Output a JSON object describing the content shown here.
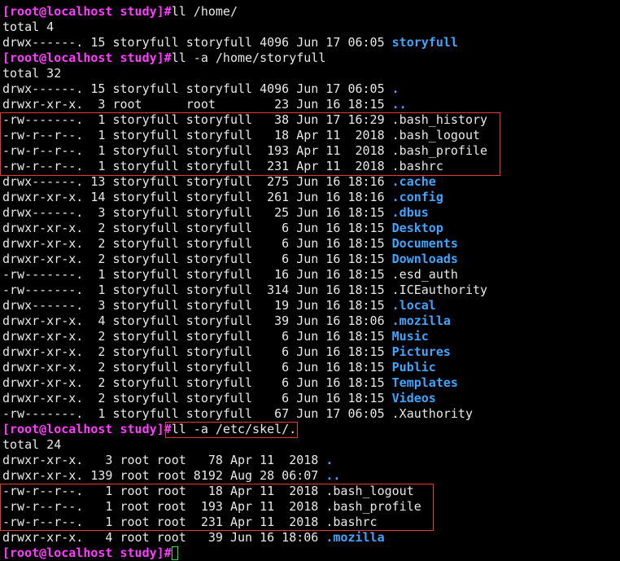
{
  "terminal": {
    "colors": {
      "prompt": "#ff3cff",
      "directory": "#3fa6ff",
      "text": "#e8e8e8",
      "highlight_box": "#e53935",
      "cursor": "#2ee62e"
    },
    "lines": [
      {
        "text": ""
      },
      {
        "prompt": "[root@localhost study]#",
        "cmd": "ll /home/"
      },
      {
        "text": "total 4"
      },
      {
        "text": "drwx------. 15 storyfull storyfull 4096 Jun 17 06:05 ",
        "name": "storyfull",
        "dir": true
      },
      {
        "prompt": "[root@localhost study]#",
        "cmd": "ll -a /home/storyfull"
      },
      {
        "text": "total 32"
      },
      {
        "text": "drwx------. 15 storyfull storyfull 4096 Jun 17 06:05 ",
        "name": ".",
        "dir": true
      },
      {
        "text": "drwxr-xr-x.  3 root      root        23 Jun 16 18:15 ",
        "name": "..",
        "dir": true
      },
      {
        "text": "-rw-------.  1 storyfull storyfull   38 Jun 17 16:29 ",
        "name": ".bash_history"
      },
      {
        "text": "-rw-r--r--.  1 storyfull storyfull   18 Apr 11  2018 ",
        "name": ".bash_logout"
      },
      {
        "text": "-rw-r--r--.  1 storyfull storyfull  193 Apr 11  2018 ",
        "name": ".bash_profile"
      },
      {
        "text": "-rw-r--r--.  1 storyfull storyfull  231 Apr 11  2018 ",
        "name": ".bashrc"
      },
      {
        "text": "drwx------. 13 storyfull storyfull  275 Jun 16 18:16 ",
        "name": ".cache",
        "dir": true
      },
      {
        "text": "drwxr-xr-x. 14 storyfull storyfull  261 Jun 16 18:16 ",
        "name": ".config",
        "dir": true
      },
      {
        "text": "drwx------.  3 storyfull storyfull   25 Jun 16 18:15 ",
        "name": ".dbus",
        "dir": true
      },
      {
        "text": "drwxr-xr-x.  2 storyfull storyfull    6 Jun 16 18:15 ",
        "name": "Desktop",
        "dir": true
      },
      {
        "text": "drwxr-xr-x.  2 storyfull storyfull    6 Jun 16 18:15 ",
        "name": "Documents",
        "dir": true
      },
      {
        "text": "drwxr-xr-x.  2 storyfull storyfull    6 Jun 16 18:15 ",
        "name": "Downloads",
        "dir": true
      },
      {
        "text": "-rw-------.  1 storyfull storyfull   16 Jun 16 18:15 ",
        "name": ".esd_auth"
      },
      {
        "text": "-rw-------.  1 storyfull storyfull  314 Jun 16 18:15 ",
        "name": ".ICEauthority"
      },
      {
        "text": "drwx------.  3 storyfull storyfull   19 Jun 16 18:15 ",
        "name": ".local",
        "dir": true
      },
      {
        "text": "drwxr-xr-x.  4 storyfull storyfull   39 Jun 16 18:06 ",
        "name": ".mozilla",
        "dir": true
      },
      {
        "text": "drwxr-xr-x.  2 storyfull storyfull    6 Jun 16 18:15 ",
        "name": "Music",
        "dir": true
      },
      {
        "text": "drwxr-xr-x.  2 storyfull storyfull    6 Jun 16 18:15 ",
        "name": "Pictures",
        "dir": true
      },
      {
        "text": "drwxr-xr-x.  2 storyfull storyfull    6 Jun 16 18:15 ",
        "name": "Public",
        "dir": true
      },
      {
        "text": "drwxr-xr-x.  2 storyfull storyfull    6 Jun 16 18:15 ",
        "name": "Templates",
        "dir": true
      },
      {
        "text": "drwxr-xr-x.  2 storyfull storyfull    6 Jun 16 18:15 ",
        "name": "Videos",
        "dir": true
      },
      {
        "text": "-rw-------.  1 storyfull storyfull   67 Jun 17 06:05 ",
        "name": ".Xauthority"
      },
      {
        "prompt": "[root@localhost study]#",
        "cmd": "ll -a /etc/skel/."
      },
      {
        "text": "total 24"
      },
      {
        "text": "drwxr-xr-x.   3 root root   78 Apr 11  2018 ",
        "name": ".",
        "dir": true
      },
      {
        "text": "drwxr-xr-x. 139 root root 8192 Aug 28 06:07 ",
        "name": "..",
        "dir": true
      },
      {
        "text": "-rw-r--r--.   1 root root   18 Apr 11  2018 ",
        "name": ".bash_logout"
      },
      {
        "text": "-rw-r--r--.   1 root root  193 Apr 11  2018 ",
        "name": ".bash_profile"
      },
      {
        "text": "-rw-r--r--.   1 root root  231 Apr 11  2018 ",
        "name": ".bashrc"
      },
      {
        "text": "drwxr-xr-x.   4 root root   39 Jun 16 18:06 ",
        "name": ".mozilla",
        "dir": true
      },
      {
        "prompt": "[root@localhost study]#",
        "cmd": "",
        "cursor": true
      }
    ]
  }
}
